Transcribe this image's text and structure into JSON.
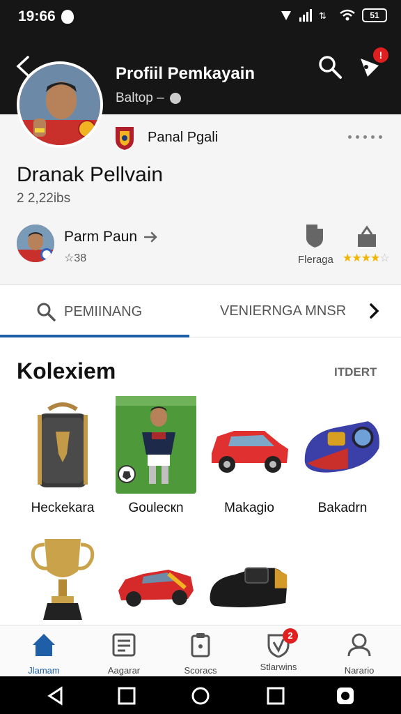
{
  "status_bar": {
    "time": "19:66",
    "battery": "51"
  },
  "header": {
    "title": "Profiil Pemkayain",
    "subtitle": "Baltop –",
    "notification_count": "!"
  },
  "profile": {
    "club_name": "Panal Pgali",
    "name": "Dranak Pellvain",
    "stat": "2 2,22ibs",
    "friend": {
      "name": "Parm Paun",
      "count": "☆38"
    },
    "rating_label": "Fleraga",
    "rating": 4
  },
  "tabs": [
    {
      "label": "PEMIINANG",
      "active": true
    },
    {
      "label": "VENIERNGA MNSR",
      "active": false
    }
  ],
  "collection": {
    "title": "Kolexiem",
    "link": "ITDERT",
    "items": [
      {
        "label": "Heckekara",
        "icon": "backpack-icon"
      },
      {
        "label": "Goulecкn",
        "icon": "soccer-player-photo"
      },
      {
        "label": "Makagio",
        "icon": "red-car-icon"
      },
      {
        "label": "Bakadrn",
        "icon": "shoe-icon"
      },
      {
        "label": "",
        "icon": "trophy-icon"
      },
      {
        "label": "",
        "icon": "race-car-icon"
      },
      {
        "label": "",
        "icon": "black-shoe-icon"
      }
    ]
  },
  "bottom_nav": [
    {
      "label": "Jlamam",
      "icon": "home-icon",
      "active": true
    },
    {
      "label": "Aagarar",
      "icon": "list-icon",
      "active": false
    },
    {
      "label": "Scoracs",
      "icon": "clipboard-icon",
      "active": false
    },
    {
      "label": "Stlarwins",
      "icon": "shield-badge-icon",
      "active": false,
      "badge": "2"
    },
    {
      "label": "Narario",
      "icon": "profile-icon",
      "active": false
    }
  ],
  "colors": {
    "accent": "#1f5fa8",
    "badge": "#e02020",
    "header_bg": "#161616"
  }
}
